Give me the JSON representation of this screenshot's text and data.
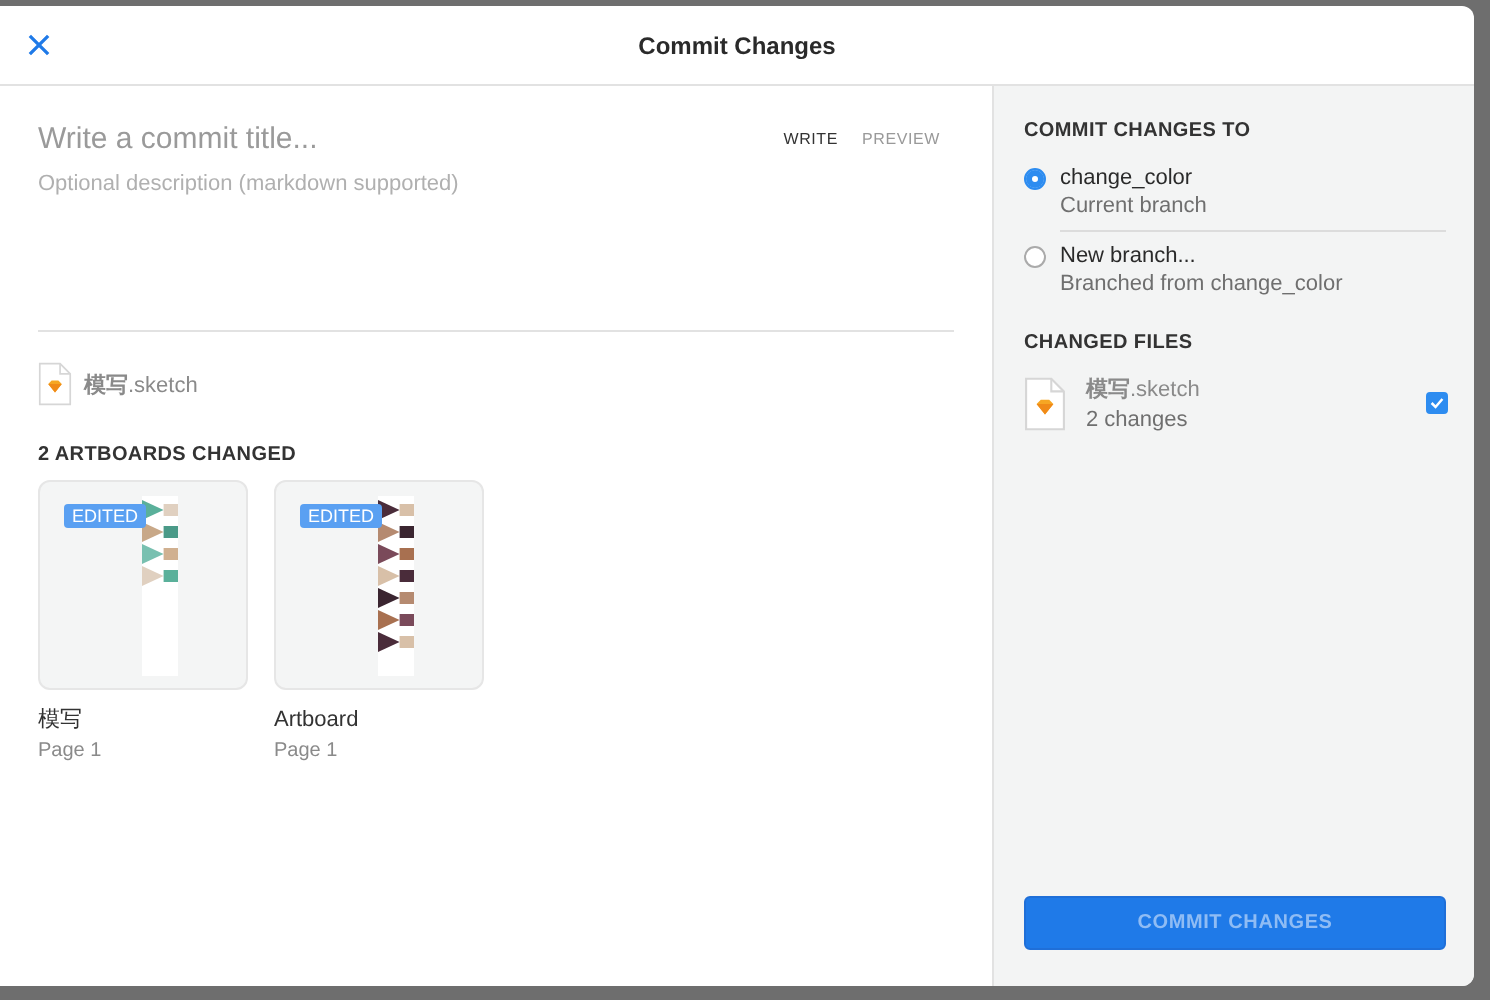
{
  "window": {
    "title": "Commit Changes"
  },
  "editor": {
    "title_placeholder": "Write a commit title...",
    "description_placeholder": "Optional description (markdown supported)",
    "tabs": [
      {
        "label": "WRITE",
        "selected": true
      },
      {
        "label": "PREVIEW",
        "selected": false
      }
    ]
  },
  "document": {
    "name": "**模写**.sketch"
  },
  "artboards": {
    "heading": "2 ARTBOARDS CHANGED",
    "items": [
      {
        "badge": "EDITED",
        "name": "模写",
        "page": "Page 1",
        "kind": "picture"
      },
      {
        "badge": "EDITED",
        "name": "Artboard",
        "page": "Page 1",
        "kind": "picture"
      }
    ]
  },
  "target": {
    "heading": "COMMIT CHANGES TO",
    "options": [
      {
        "label": "change_color",
        "sub": "Current branch",
        "selected": true
      },
      {
        "label": "New branch...",
        "sub": "Branched from change_color",
        "selected": false
      }
    ]
  },
  "changed_files": {
    "heading": "CHANGED FILES",
    "files": [
      {
        "name": "**模写**.sketch",
        "changes": "2 changes",
        "checked": true
      }
    ]
  },
  "commit_button": {
    "label": "COMMIT CHANGES",
    "disabled": true
  }
}
